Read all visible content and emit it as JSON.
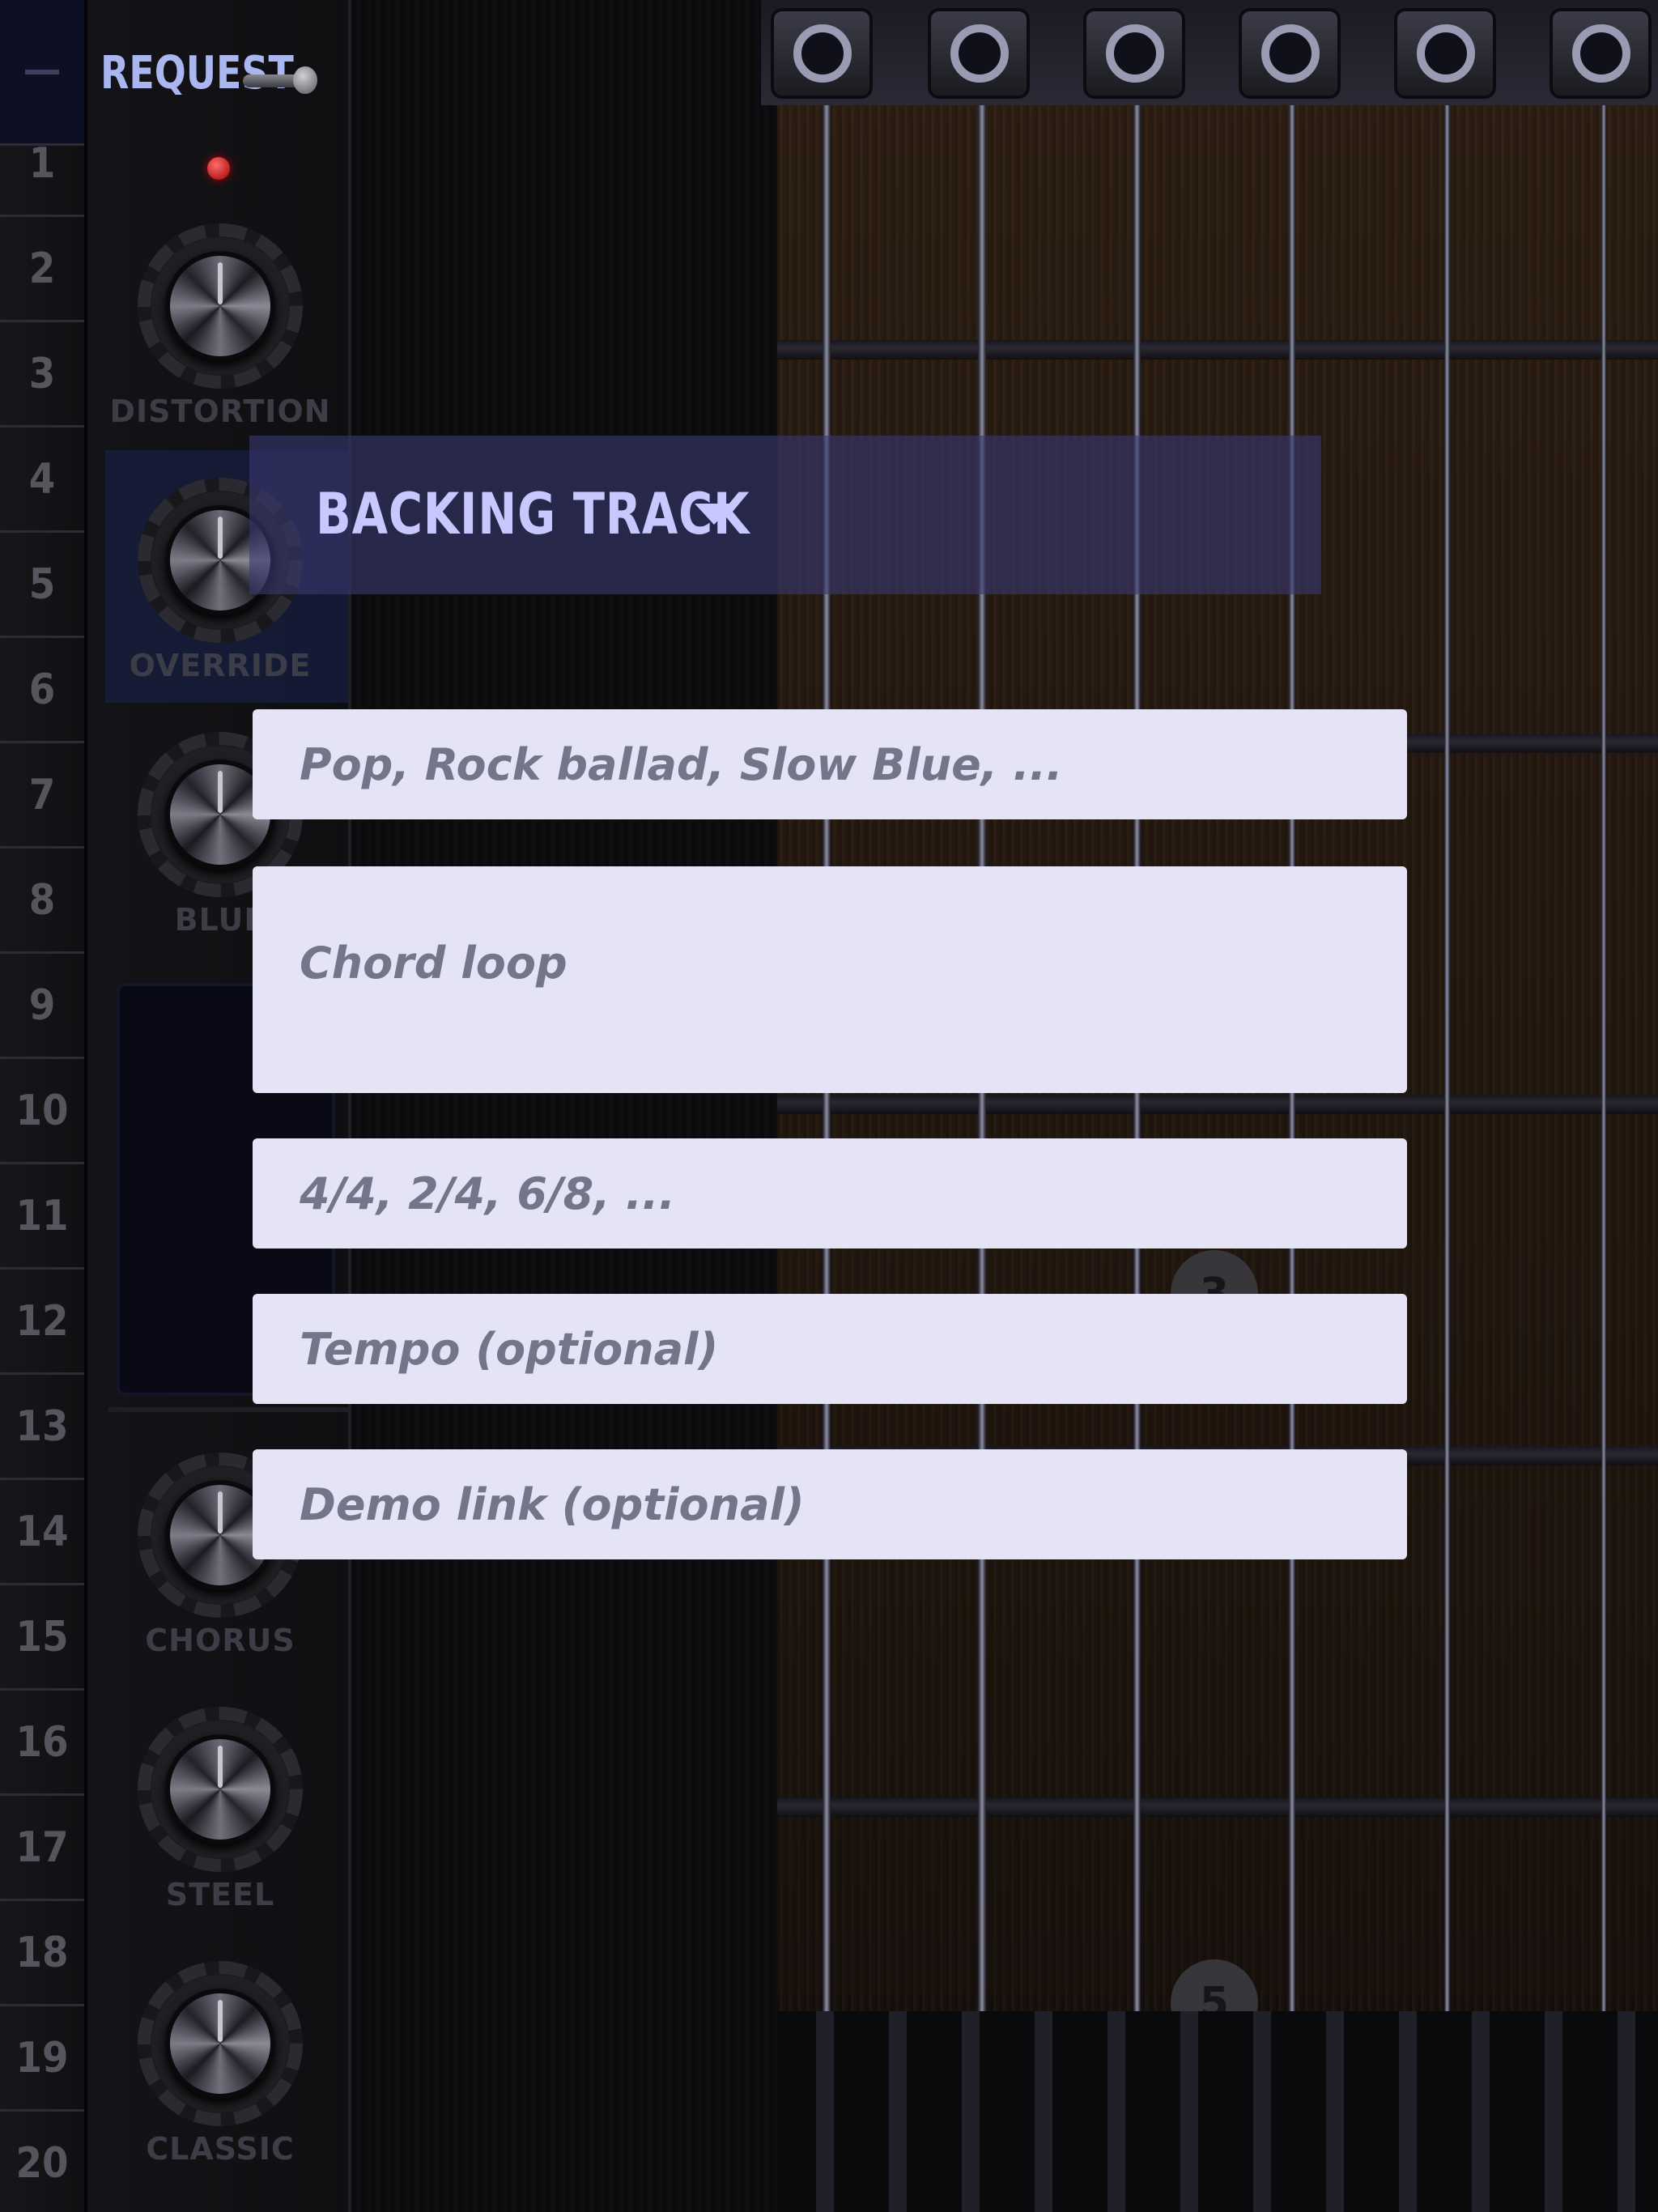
{
  "fret_numbers": [
    "1",
    "2",
    "3",
    "4",
    "5",
    "6",
    "7",
    "8",
    "9",
    "10",
    "11",
    "12",
    "13",
    "14",
    "15",
    "16",
    "17",
    "18",
    "19",
    "20"
  ],
  "controls": {
    "request_label": "REQUEST",
    "knobs": [
      "DISTORTION",
      "OVERRIDE",
      "BLUE",
      "CHORUS",
      "STEEL",
      "CLASSIC"
    ]
  },
  "fret_markers": [
    "3",
    "5"
  ],
  "request_panel": {
    "title": "BACKING TRACK",
    "fields": {
      "style": {
        "value": "",
        "placeholder": "Pop, Rock ballad, Slow Blue, ..."
      },
      "chord_loop": {
        "value": "",
        "placeholder": "Chord loop"
      },
      "time_signature": {
        "value": "",
        "placeholder": "4/4, 2/4, 6/8, ..."
      },
      "tempo": {
        "value": "",
        "placeholder": "Tempo (optional)"
      },
      "demo_link": {
        "value": "",
        "placeholder": "Demo link (optional)"
      }
    }
  },
  "colors": {
    "accent": "#c8c8ff",
    "field_bg": "#e4e4f6",
    "header_bg": "#383870",
    "led": "#d40000"
  },
  "icons": [
    "menu-icon",
    "toggle-switch-icon",
    "led-indicator-icon",
    "dropdown-caret-icon",
    "tuning-peg-icon"
  ]
}
